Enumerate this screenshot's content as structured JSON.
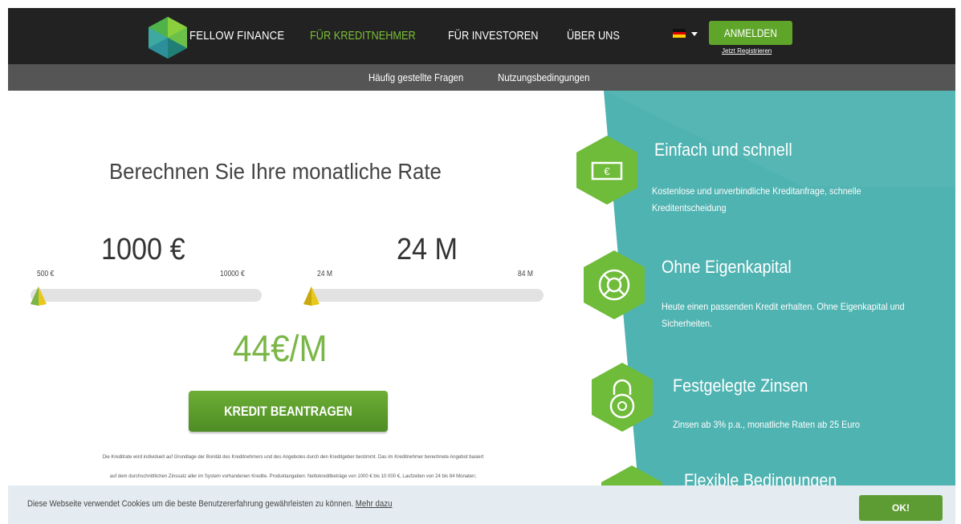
{
  "nav": {
    "brand": "FELLOW FINANCE",
    "links": [
      "FÜR KREDITNEHMER",
      "FÜR INVESTOREN",
      "ÜBER UNS"
    ],
    "login": "ANMELDEN",
    "register": "Jetzt Registrieren",
    "flag_colors": [
      "#111111",
      "#dd0000",
      "#ffce00"
    ]
  },
  "subnav": {
    "links": [
      "Häufig gestellte Fragen",
      "Nutzungsbedingungen"
    ]
  },
  "calculator": {
    "title": "Berechnen Sie Ihre monatliche Rate",
    "amount": "1000 €",
    "amount_min": "500 €",
    "amount_max": "10000 €",
    "amount_slider_fraction": 0.0,
    "months": "24 M",
    "months_min": "24 M",
    "months_max": "84 M",
    "months_slider_fraction": 0.0,
    "rate": "44€/M",
    "apply_button": "KREDIT BEANTRAGEN",
    "disclaimer": [
      "Die Kreditrate wird individuell auf Grundlage der Bonität des Kreditnehmers und des Angebotes durch den Kreditgeber bestimmt. Das im Kreditnehmer berechnete Angebot basiert",
      "auf dem durchschnittlichen Zinssatz aller im System vorhandenen Kredite. Produktangaben: Nettokreditbeträge von 1000 € bis 10 000 €, Laufzeiten von 24 bis 84 Monaten;"
    ]
  },
  "features": [
    {
      "title": "Einfach und schnell",
      "text": "Kostenlose und unverbindliche Kreditanfrage, schnelle Kreditentscheidung",
      "icon": "money-bill-icon"
    },
    {
      "title": "Ohne Eigenkapital",
      "text": "Heute einen passenden Kredit erhalten. Ohne Eigenkapital und Sicherheiten.",
      "icon": "lifebuoy-icon"
    },
    {
      "title": "Festgelegte Zinsen",
      "text": "Zinsen ab 3% p.a., monatliche Raten ab 25 Euro",
      "icon": "padlock-icon"
    },
    {
      "title": "Flexible Bedingungen",
      "text": "",
      "icon": "hexagon-icon"
    }
  ],
  "cookie": {
    "text": "Diese Webseite verwendet Cookies um die beste Benutzererfahrung gewährleisten zu können.",
    "link": "Mehr dazu",
    "ok": "OK!"
  },
  "colors": {
    "accent_green": "#7ab648",
    "button_green": "#5fa52a",
    "teal": "#4fb3b1",
    "nav_dark": "#222222",
    "subnav_gray": "#555555"
  }
}
